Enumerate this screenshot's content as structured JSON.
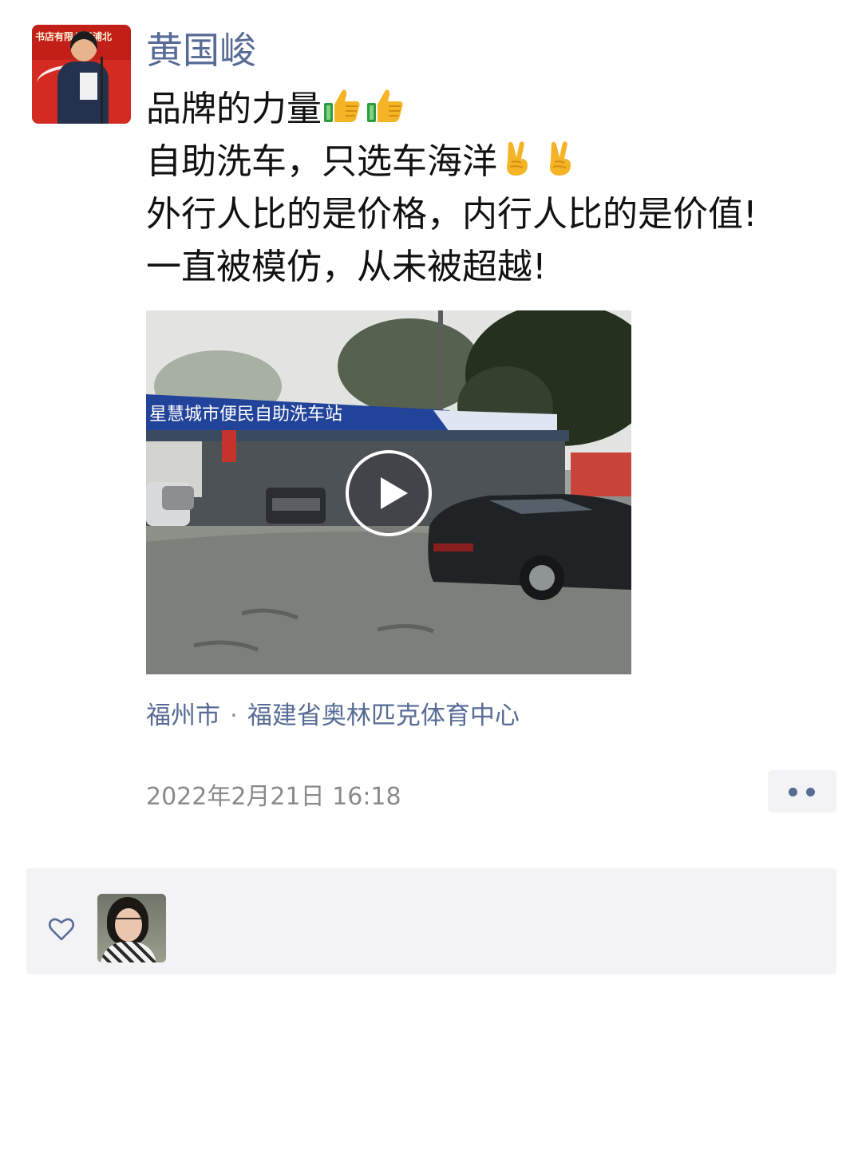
{
  "post": {
    "author_name": "黄国峻",
    "avatar_banner_text": "书店有限公司浦北",
    "lines": [
      {
        "text": "品牌的力量",
        "emoji": [
          "thumbs-up-icon",
          "thumbs-up-icon"
        ]
      },
      {
        "text": "自助洗车，只选车海洋",
        "emoji": [
          "victory-hand-icon",
          "victory-hand-icon"
        ]
      },
      {
        "text": "外行人比的是价格，内行人比的是价值!",
        "emoji": []
      },
      {
        "text": "一直被模仿，从未被超越!",
        "emoji": []
      }
    ],
    "video": {
      "sign_text": "星慧城市便民自助洗车站",
      "play_icon": "play-icon"
    },
    "location": {
      "city": "福州市",
      "separator": "·",
      "place": "福建省奥林匹克体育中心"
    },
    "timestamp": "2022年2月21日 16:18",
    "more_icon": "more-dots-icon"
  },
  "likes": {
    "heart_icon": "heart-outline-icon",
    "count_shown": 1
  },
  "colors": {
    "link_blue": "#576b95",
    "timestamp_gray": "#8a8a8a",
    "panel_bg": "#f3f3f5"
  }
}
